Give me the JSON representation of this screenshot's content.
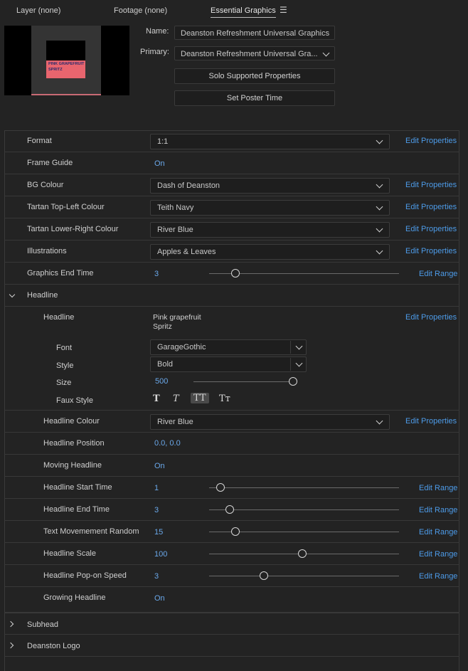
{
  "tabs": [
    {
      "label": "Layer (none)"
    },
    {
      "label": "Footage (none)"
    },
    {
      "label": "Essential Graphics"
    }
  ],
  "preview": {
    "line1": "PINK GRAPEFRUIT",
    "line2": "SPRITZ"
  },
  "template": {
    "name_label": "Name:",
    "name_value": "Deanston Refreshment Universal Graphics",
    "primary_label": "Primary:",
    "primary_value": "Deanston Refreshment Universal Gra...",
    "solo_button": "Solo Supported Properties",
    "poster_button": "Set Poster Time"
  },
  "links": {
    "edit_properties": "Edit Properties",
    "edit_range": "Edit Range"
  },
  "properties": {
    "format": {
      "label": "Format",
      "value": "1:1"
    },
    "frame_guide": {
      "label": "Frame Guide",
      "value": "On"
    },
    "bg_colour": {
      "label": "BG Colour",
      "value": "Dash of Deanston"
    },
    "tartan_tl": {
      "label": "Tartan Top-Left Colour",
      "value": "Teith Navy"
    },
    "tartan_lr": {
      "label": "Tartan Lower-Right Colour",
      "value": "River Blue"
    },
    "illustrations": {
      "label": "Illustrations",
      "value": "Apples & Leaves"
    },
    "graphics_end": {
      "label": "Graphics End Time",
      "value": "3",
      "level": 0.14
    }
  },
  "headline_group": {
    "label": "Headline",
    "text_label": "Headline",
    "text_line1": "Pink grapefruit",
    "text_line2": "Spritz",
    "font_label": "Font",
    "font_value": "GarageGothic",
    "style_label": "Style",
    "style_value": "Bold",
    "size_label": "Size",
    "size_value": "500",
    "size_level": 1.0,
    "faux_label": "Faux Style",
    "faux": [
      "T",
      "T",
      "TT",
      "Tт"
    ],
    "colour": {
      "label": "Headline Colour",
      "value": "River Blue"
    },
    "position": {
      "label": "Headline Position",
      "value": "0.0, 0.0"
    },
    "moving": {
      "label": "Moving Headline",
      "value": "On"
    },
    "start_time": {
      "label": "Headline Start Time",
      "value": "1",
      "level": 0.06
    },
    "end_time": {
      "label": "Headline End Time",
      "value": "3",
      "level": 0.11
    },
    "random": {
      "label": "Text Movemement Random",
      "value": "15",
      "level": 0.14
    },
    "scale": {
      "label": "Headline Scale",
      "value": "100",
      "level": 0.49
    },
    "popon": {
      "label": "Headline Pop-on Speed",
      "value": "3",
      "level": 0.29
    },
    "growing": {
      "label": "Growing Headline",
      "value": "On"
    }
  },
  "groups": {
    "subhead": "Subhead",
    "logo": "Deanston Logo"
  }
}
